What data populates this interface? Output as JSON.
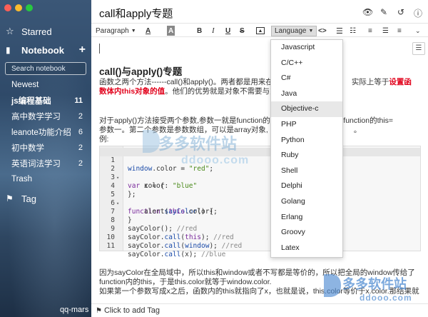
{
  "sidebar": {
    "starred_label": "Starred",
    "notebook_label": "Notebook",
    "add_symbol": "+",
    "search_placeholder": "Search notebook",
    "items": [
      {
        "name": "Newest",
        "count": "",
        "bold": false
      },
      {
        "name": "js编程基础",
        "count": "11",
        "bold": true
      },
      {
        "name": "高中数学学习",
        "count": "2",
        "bold": false
      },
      {
        "name": "leanote功能介绍",
        "count": "6",
        "bold": false
      },
      {
        "name": "初中数学",
        "count": "2",
        "bold": false
      },
      {
        "name": "英语词法学习",
        "count": "2",
        "bold": false
      },
      {
        "name": "Trash",
        "count": "",
        "bold": false
      }
    ],
    "tag_label": "Tag",
    "user": "qq-mars"
  },
  "note": {
    "title": "call和apply专题",
    "heading": "call()与apply()专题",
    "para1_a": "函数之两个方法------call()和apply()。两者都是用来在",
    "para1_b": "实际上等于",
    "para1_red1": "设置函",
    "para1_red2": "数体内this对象的值",
    "para1_c": "。他们的优势就是对象不需要与方",
    "para2_a": "对于apply()方法接受两个参数,参数一就是function的",
    "para2_b": "把function的this=",
    "para2_c": "参数一。第二个参数是参数数组，可以是array对象,",
    "para2_d": "。",
    "para2_e": "例:",
    "para3_l1": "因为sayColor在全局域中，所以this和window或者不写都是等价的，所以把全局的window传给了",
    "para3_l2": "function内的this，于是this.color就等于window.color.",
    "para3_l3": "如果第一个参数写成x之后，函数内的this就指向了x，也就是说，this.color等价于x.color.那结果就"
  },
  "toolbar": {
    "paragraph": "Paragraph",
    "font_color": "A",
    "bg_color": "A",
    "bold": "B",
    "italic": "I",
    "underline": "U",
    "strike": "S",
    "language": "Language",
    "code": "<>",
    "ul": "☰",
    "ol": "☷"
  },
  "code_lines": [
    {
      "n": "1",
      "fold": ""
    },
    {
      "n": "2",
      "fold": "▾"
    },
    {
      "n": "3",
      "fold": ""
    },
    {
      "n": "4",
      "fold": ""
    },
    {
      "n": "5",
      "fold": "▾"
    },
    {
      "n": "6",
      "fold": ""
    },
    {
      "n": "7",
      "fold": ""
    },
    {
      "n": "8",
      "fold": ""
    },
    {
      "n": "9",
      "fold": ""
    },
    {
      "n": "10",
      "fold": ""
    },
    {
      "n": "11",
      "fold": ""
    }
  ],
  "code_text": {
    "l1_obj": "window",
    "l1_rest": ".color = ",
    "l1_str": "\"red\"",
    "l1_end": ";",
    "l2_kw": "var",
    "l2_rest": " x = {",
    "l3_rest": "    color: ",
    "l3_str": "\"blue\"",
    "l4": "};",
    "l5_kw": "function",
    "l5_fn": " sayColor",
    "l5_rest": "() {",
    "l6_a": "    alert(",
    "l6_kw": "this",
    "l6_b": ".color);",
    "l7": "}",
    "l8_a": "sayColor(); ",
    "l8_cm": "//red",
    "l9_a": "sayColor.",
    "l9_fn": "call",
    "l9_b": "(",
    "l9_kw": "this",
    "l9_c": "); ",
    "l9_cm": "//red",
    "l10_a": "sayColor.",
    "l10_fn": "call",
    "l10_b": "(",
    "l10_obj": "window",
    "l10_c": "); ",
    "l10_cm": "//red",
    "l11_a": "sayColor.",
    "l11_fn": "call",
    "l11_b": "(x); ",
    "l11_cm": "//blue"
  },
  "language_menu": {
    "items": [
      "Javascript",
      "C/C++",
      "C#",
      "Java",
      "Objective-c",
      "PHP",
      "Python",
      "Ruby",
      "Shell",
      "Delphi",
      "Golang",
      "Erlang",
      "Groovy",
      "Latex"
    ],
    "active": "Objective-c"
  },
  "footer": {
    "add_tag": "Click to add Tag"
  },
  "watermark": {
    "brand": "多多软件站",
    "domain": "ddooo.com"
  }
}
